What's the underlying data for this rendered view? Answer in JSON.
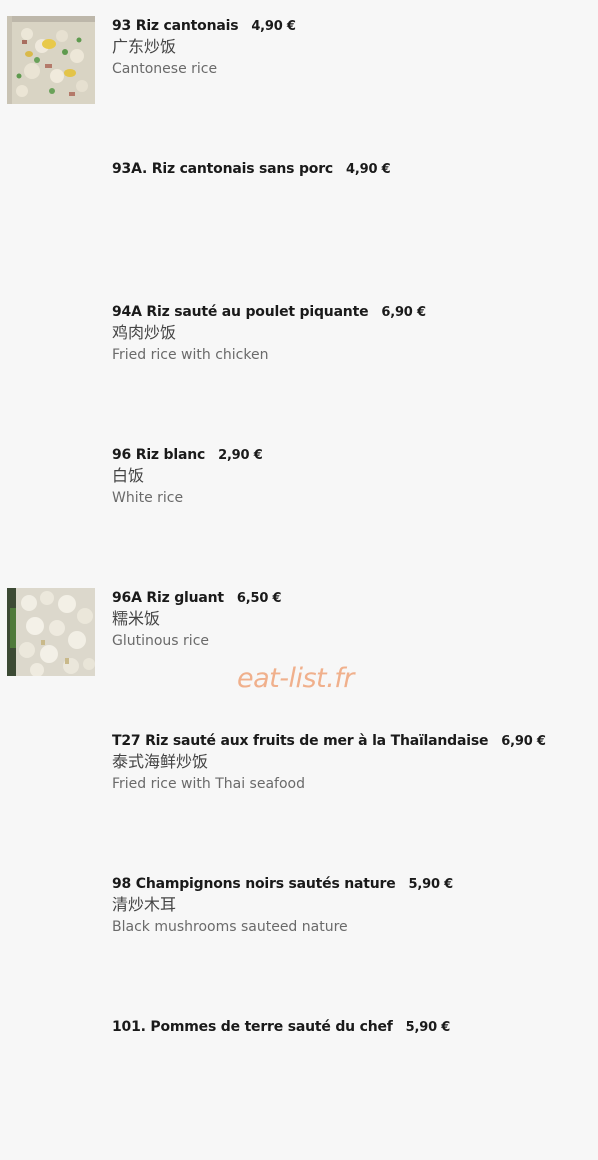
{
  "watermark": "eat-list.fr",
  "items": [
    {
      "name": "93 Riz cantonais",
      "price": "4,90 €",
      "chinese": "广东炒饭",
      "english": "Cantonese rice",
      "image": "cantonese-rice-photo"
    },
    {
      "name": "93A. Riz cantonais sans porc",
      "price": "4,90 €",
      "chinese": "",
      "english": ""
    },
    {
      "name": "94A Riz sauté au poulet piquante",
      "price": "6,90 €",
      "chinese": "鸡肉炒饭",
      "english": "Fried rice with chicken"
    },
    {
      "name": "96 Riz blanc",
      "price": "2,90 €",
      "chinese": "白饭",
      "english": "White rice"
    },
    {
      "name": "96A Riz gluant",
      "price": "6,50 €",
      "chinese": "糯米饭",
      "english": "Glutinous rice",
      "image": "glutinous-rice-photo"
    },
    {
      "name": "T27 Riz sauté aux fruits de mer à la Thaïlandaise",
      "price": "6,90 €",
      "chinese": "泰式海鲜炒饭",
      "english": "Fried rice with Thai seafood"
    },
    {
      "name": "98 Champignons noirs sautés nature",
      "price": "5,90 €",
      "chinese": "清炒木耳",
      "english": "Black mushrooms sauteed nature"
    },
    {
      "name": "101. Pommes de terre sauté du chef",
      "price": "5,90 €",
      "chinese": "",
      "english": ""
    }
  ]
}
